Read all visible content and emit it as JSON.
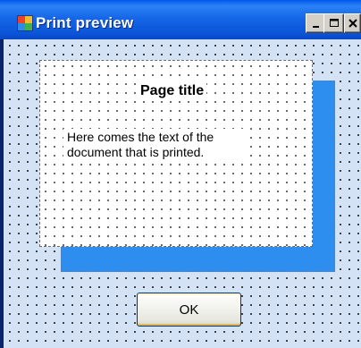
{
  "window": {
    "title": "Print preview",
    "icon": "print-preview-app-icon",
    "controls": {
      "minimize_icon": "minimize-icon",
      "maximize_icon": "maximize-icon",
      "close_icon": "close-icon"
    }
  },
  "preview": {
    "page_title": "Page title",
    "body_text": "Here comes the text of the document that is printed.",
    "shadow_color": "#2e8ef0",
    "background_color": "#d4e2f6"
  },
  "buttons": {
    "ok_label": "OK"
  }
}
